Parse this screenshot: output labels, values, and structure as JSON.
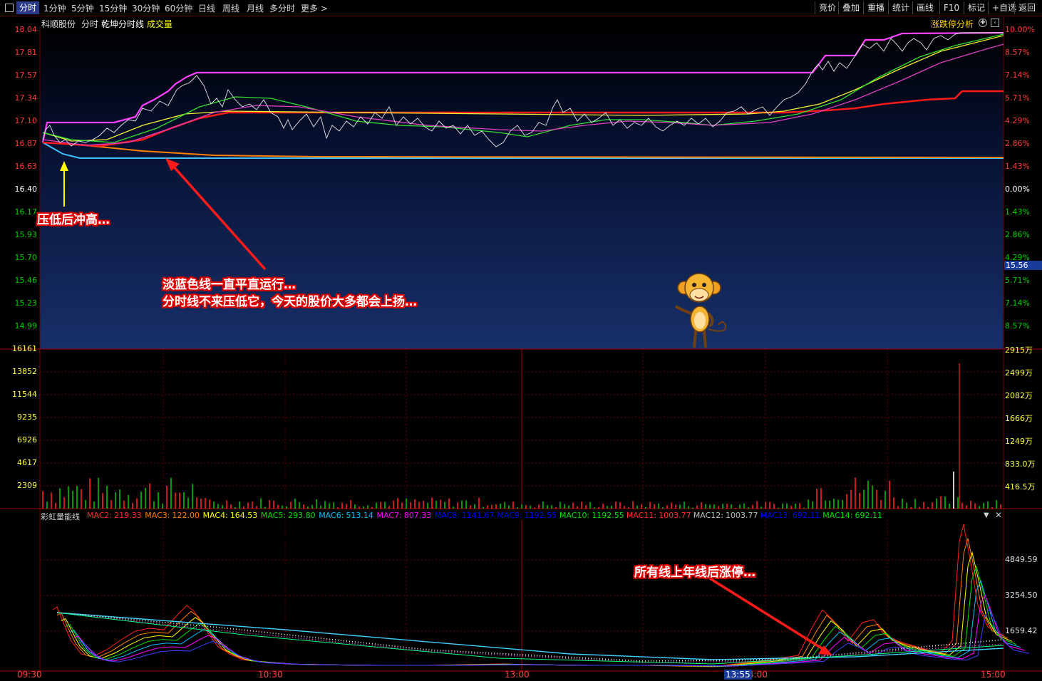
{
  "toolbar": {
    "tabs": [
      "分时",
      "1分钟",
      "5分钟",
      "15分钟",
      "30分钟",
      "60分钟",
      "日线",
      "周线",
      "月线",
      "多分时",
      "更多 >"
    ],
    "right_buttons": [
      "竞价",
      "叠加",
      "重播",
      "统计",
      "画线",
      "F10",
      "标记",
      "+自选",
      "返回"
    ]
  },
  "header": {
    "stock_name": "科顺股份",
    "mode": "分时",
    "indicator": "乾坤分时线",
    "volume_label": "成交量",
    "panel_button": "涨跌停分析"
  },
  "price_axis": {
    "left": [
      "18.04",
      "17.81",
      "17.57",
      "17.34",
      "17.10",
      "16.87",
      "16.63",
      "16.40",
      "16.17",
      "15.93",
      "15.70",
      "15.46",
      "15.23",
      "14.99"
    ],
    "right": [
      "10.00%",
      "8.57%",
      "7.14%",
      "5.71%",
      "4.29%",
      "2.86%",
      "1.43%",
      "0.00%",
      "1.43%",
      "2.86%",
      "4.29%",
      "5.71%",
      "7.14%",
      "8.57%"
    ],
    "current_price_tag": "15.56"
  },
  "volume_axis": {
    "left": [
      "16161",
      "13852",
      "11544",
      "9235",
      "6926",
      "4617",
      "2309"
    ],
    "right": [
      "2915万",
      "2499万",
      "2082万",
      "1666万",
      "1249万",
      "833.0万",
      "416.5万"
    ]
  },
  "indicator_panel": {
    "name": "彩虹量能线",
    "values": [
      {
        "label": "MAC2:",
        "value": "219.33",
        "color": "#ff3030"
      },
      {
        "label": "MAC3:",
        "value": "122.00",
        "color": "#ff7f00"
      },
      {
        "label": "MAC4:",
        "value": "164.53",
        "color": "#ffff00"
      },
      {
        "label": "MAC5:",
        "value": "293.80",
        "color": "#00e000"
      },
      {
        "label": "MAC6:",
        "value": "513.14",
        "color": "#00c0ff"
      },
      {
        "label": "MAC7:",
        "value": "807.33",
        "color": "#ff00ff"
      },
      {
        "label": "MAC8:",
        "value": "1141.67",
        "color": "#0000ff"
      },
      {
        "label": "MAC9:",
        "value": "1192.55",
        "color": "#0000ff"
      },
      {
        "label": "MAC10:",
        "value": "1192.55",
        "color": "#00e000"
      },
      {
        "label": "MAC11:",
        "value": "1003.77",
        "color": "#ff3030"
      },
      {
        "label": "MAC12:",
        "value": "1003.77",
        "color": "#c0c0c0"
      },
      {
        "label": "MAC13:",
        "value": "692.11",
        "color": "#0000ff"
      },
      {
        "label": "MAC14:",
        "value": "692.11",
        "color": "#00e000"
      }
    ],
    "axis_right": [
      "4849.59",
      "3254.50",
      "1659.42"
    ]
  },
  "time_axis": {
    "labels": [
      "09:30",
      "10:30",
      "13:00",
      "4:00",
      "15:00"
    ],
    "cursor_time": "13:55"
  },
  "annotations": {
    "a1": "压低后冲高…",
    "a2_line1": "淡蓝色线一直平直运行…",
    "a2_line2": "分时线不来压低它，今天的股价大多都会上扬…",
    "a3": "所有线上年线后涨停…"
  },
  "colors": {
    "limit_up_line": "#ff40ff",
    "light_blue_line": "#40c0ff",
    "orange_line": "#ff8000",
    "grid": "#6a0000"
  }
}
